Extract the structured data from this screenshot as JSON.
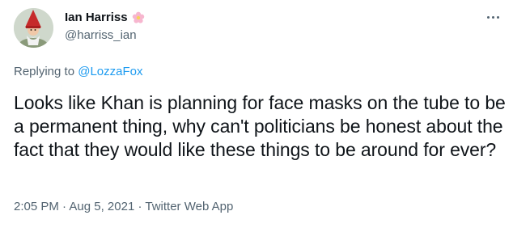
{
  "author": {
    "display_name": "Ian Harriss",
    "handle": "@harriss_ian",
    "badge_icon": "flower-icon",
    "avatar_icon": "gnome-avatar"
  },
  "reply": {
    "prefix": "Replying to",
    "mention": "@LozzaFox"
  },
  "tweet": {
    "text": "Looks like Khan is planning for face masks on the tube to be a permanent thing, why can't politicians be honest about the fact that they would like these things to be around for ever?"
  },
  "meta": {
    "time": "2:05 PM",
    "separator": "·",
    "date": "Aug 5, 2021",
    "source": "Twitter Web App"
  },
  "colors": {
    "text_primary": "#0f1419",
    "text_secondary": "#536471",
    "link": "#1d9bf0",
    "background": "#ffffff"
  }
}
